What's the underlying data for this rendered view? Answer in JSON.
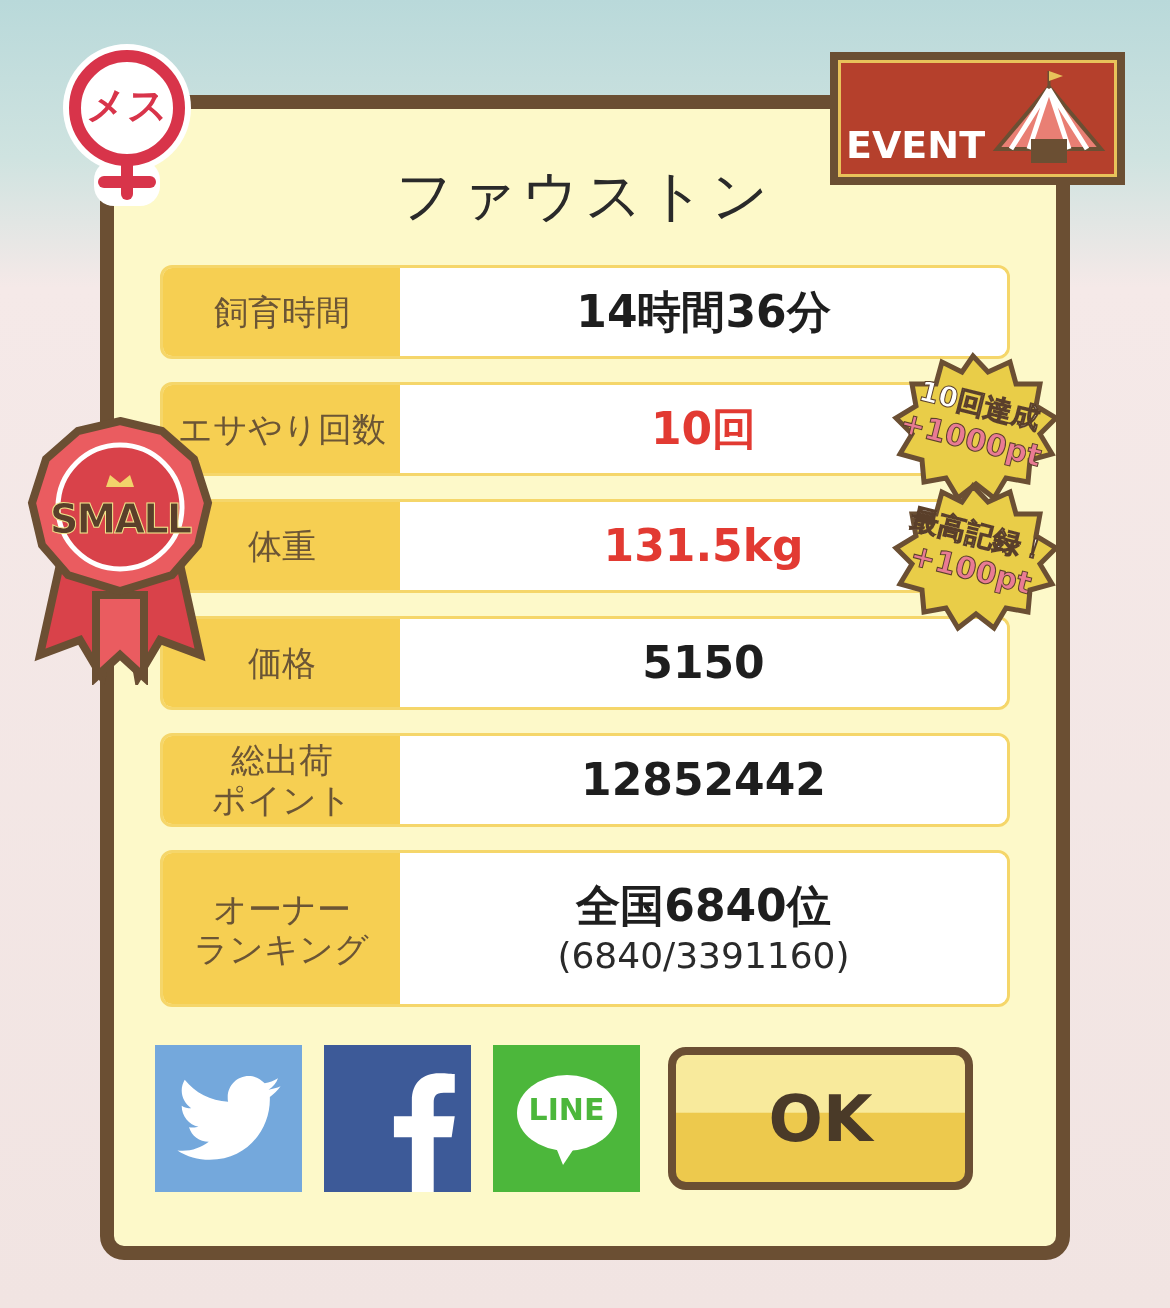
{
  "gender_badge": {
    "label": "メス"
  },
  "event_banner": {
    "label": "EVENT"
  },
  "title": "ファウストン",
  "rank_ribbon": {
    "label": "SMALL"
  },
  "stats": [
    {
      "label_lines": [
        "飼育時間"
      ],
      "value": "14時間36分",
      "highlighted": false
    },
    {
      "label_lines": [
        "エサやり回数"
      ],
      "value": "10回",
      "highlighted": true
    },
    {
      "label_lines": [
        "体重"
      ],
      "value": "131.5kg",
      "highlighted": true
    },
    {
      "label_lines": [
        "価格"
      ],
      "value": "5150",
      "highlighted": false
    },
    {
      "label_lines": [
        "総出荷",
        "ポイント"
      ],
      "value": "12852442",
      "highlighted": false
    },
    {
      "label_lines": [
        "オーナー",
        "ランキング"
      ],
      "value": "全国6840位",
      "detail": "(6840/3391160)",
      "highlighted": false
    }
  ],
  "bonuses": [
    {
      "title": "10回達成",
      "points": "+1000pt"
    },
    {
      "title": "最高記録！",
      "points": "+100pt"
    }
  ],
  "share_buttons": [
    {
      "kind": "twitter"
    },
    {
      "kind": "facebook"
    },
    {
      "kind": "line",
      "label": "LINE"
    }
  ],
  "ok_button": "OK"
}
